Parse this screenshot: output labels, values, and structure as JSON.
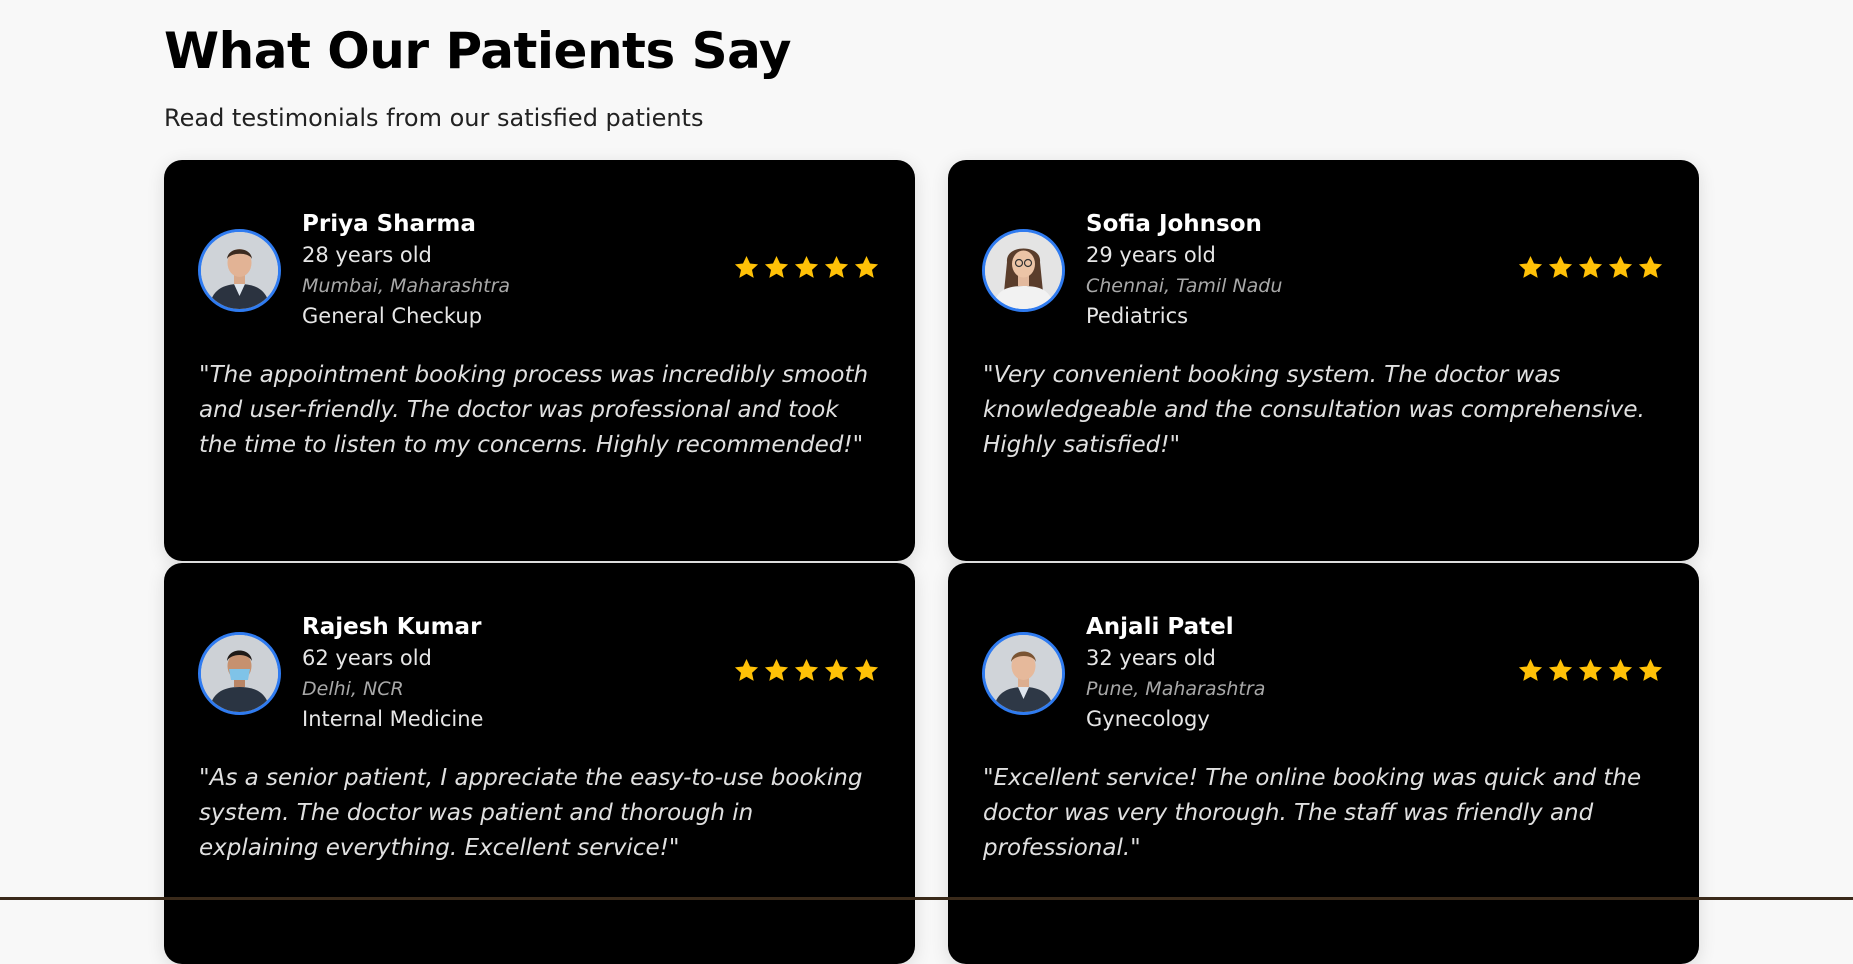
{
  "section": {
    "title": "What Our Patients Say",
    "subtitle": "Read testimonials from our satisfied patients"
  },
  "colors": {
    "card_bg": "#000000",
    "avatar_border": "#2f7bf0",
    "star": "#ffc107"
  },
  "testimonials": [
    {
      "name": "Priya Sharma",
      "age": "28 years old",
      "location": "Mumbai, Maharashtra",
      "specialty": "General Checkup",
      "rating": 5,
      "quote": "\"The appointment booking process was incredibly smooth and user-friendly. The doctor was professional and took the time to listen to my concerns. Highly recommended!\""
    },
    {
      "name": "Sofia Johnson",
      "age": "29 years old",
      "location": "Chennai, Tamil Nadu",
      "specialty": "Pediatrics",
      "rating": 5,
      "quote": "\"Very convenient booking system. The doctor was knowledgeable and the consultation was comprehensive. Highly satisfied!\""
    },
    {
      "name": "Rajesh Kumar",
      "age": "62 years old",
      "location": "Delhi, NCR",
      "specialty": "Internal Medicine",
      "rating": 5,
      "quote": "\"As a senior patient, I appreciate the easy-to-use booking system. The doctor was patient and thorough in explaining everything. Excellent service!\""
    },
    {
      "name": "Anjali Patel",
      "age": "32 years old",
      "location": "Pune, Maharashtra",
      "specialty": "Gynecology",
      "rating": 5,
      "quote": "\"Excellent service! The online booking was quick and the doctor was very thorough. The staff was friendly and professional.\""
    }
  ]
}
